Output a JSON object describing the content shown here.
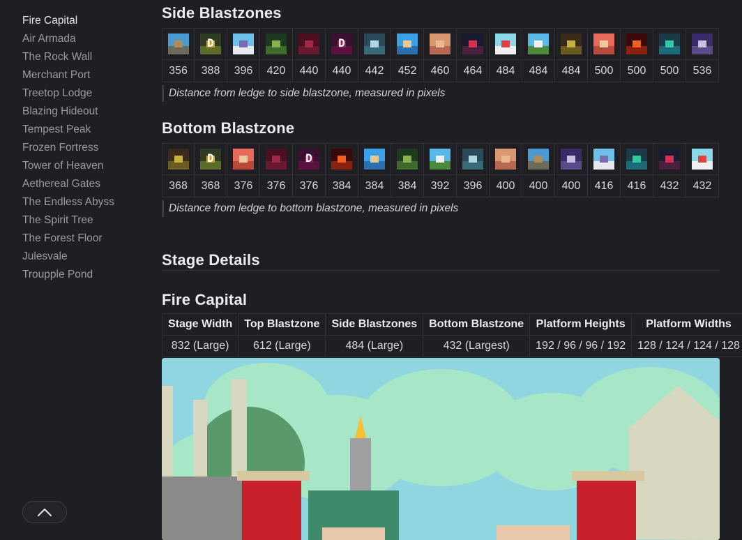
{
  "sidebar": {
    "items": [
      {
        "label": "Fire Capital",
        "active": true
      },
      {
        "label": "Air Armada"
      },
      {
        "label": "The Rock Wall"
      },
      {
        "label": "Merchant Port"
      },
      {
        "label": "Treetop Lodge"
      },
      {
        "label": "Blazing Hideout"
      },
      {
        "label": "Tempest Peak"
      },
      {
        "label": "Frozen Fortress"
      },
      {
        "label": "Tower of Heaven"
      },
      {
        "label": "Aethereal Gates"
      },
      {
        "label": "The Endless Abyss"
      },
      {
        "label": "The Spirit Tree"
      },
      {
        "label": "The Forest Floor"
      },
      {
        "label": "Julesvale"
      },
      {
        "label": "Troupple Pond"
      }
    ],
    "scroll_top_icon": "chevron-up-icon"
  },
  "side": {
    "heading": "Side Blastzones",
    "caption": "Distance from ledge to side blastzone, measured in pixels",
    "entries": [
      {
        "value": "356",
        "sky": "#4a9bd1",
        "ground": "#6b6b5a",
        "block": "#b08a5a",
        "glyph": ""
      },
      {
        "value": "388",
        "sky": "#2f3a22",
        "ground": "#5a6b2a",
        "block": "#c8a030",
        "glyph": "D"
      },
      {
        "value": "396",
        "sky": "#6fc0e8",
        "ground": "#e8e8f0",
        "block": "#7a6ab0",
        "glyph": ""
      },
      {
        "value": "420",
        "sky": "#1e3a1e",
        "ground": "#3e6b2a",
        "block": "#8ab050",
        "glyph": ""
      },
      {
        "value": "440",
        "sky": "#4a1020",
        "ground": "#6a1830",
        "block": "#a02848",
        "glyph": ""
      },
      {
        "value": "440",
        "sky": "#3a1030",
        "ground": "#5a1040",
        "block": "#8a2050",
        "glyph": "D"
      },
      {
        "value": "442",
        "sky": "#2a4a5a",
        "ground": "#3a6a7a",
        "block": "#b0d8e0",
        "glyph": ""
      },
      {
        "value": "452",
        "sky": "#3aa0e8",
        "ground": "#2a70b0",
        "block": "#e8c890",
        "glyph": ""
      },
      {
        "value": "460",
        "sky": "#d89870",
        "ground": "#b86850",
        "block": "#e8b890",
        "glyph": ""
      },
      {
        "value": "464",
        "sky": "#1a1a30",
        "ground": "#4a2040",
        "block": "#d83050",
        "glyph": ""
      },
      {
        "value": "484",
        "sky": "#8ad8e8",
        "ground": "#f0f0f0",
        "block": "#e04040",
        "glyph": ""
      },
      {
        "value": "484",
        "sky": "#5ab8e8",
        "ground": "#4a8a3a",
        "block": "#f0f0f0",
        "glyph": ""
      },
      {
        "value": "484",
        "sky": "#3a2a1a",
        "ground": "#6a5a20",
        "block": "#c8b040",
        "glyph": ""
      },
      {
        "value": "500",
        "sky": "#e86a5a",
        "ground": "#b84a3a",
        "block": "#f0c8a0",
        "glyph": ""
      },
      {
        "value": "500",
        "sky": "#3a0a0a",
        "ground": "#8a2010",
        "block": "#f06020",
        "glyph": ""
      },
      {
        "value": "500",
        "sky": "#1a3a4a",
        "ground": "#1a6a7a",
        "block": "#30c8a0",
        "glyph": ""
      },
      {
        "value": "536",
        "sky": "#3a2a6a",
        "ground": "#5a4a8a",
        "block": "#c8c0e0",
        "glyph": ""
      }
    ]
  },
  "bottom": {
    "heading": "Bottom Blastzone",
    "caption": "Distance from ledge to bottom blastzone, measured in pixels",
    "entries": [
      {
        "value": "368",
        "sky": "#3a2a1a",
        "ground": "#6a5a20",
        "block": "#c8b040",
        "glyph": ""
      },
      {
        "value": "368",
        "sky": "#2f3a22",
        "ground": "#5a6b2a",
        "block": "#c8a030",
        "glyph": "D"
      },
      {
        "value": "376",
        "sky": "#e86a5a",
        "ground": "#b84a3a",
        "block": "#f0c8a0",
        "glyph": ""
      },
      {
        "value": "376",
        "sky": "#4a1020",
        "ground": "#6a1830",
        "block": "#a02848",
        "glyph": ""
      },
      {
        "value": "376",
        "sky": "#3a1030",
        "ground": "#5a1040",
        "block": "#8a2050",
        "glyph": "D"
      },
      {
        "value": "384",
        "sky": "#3a0a0a",
        "ground": "#8a2010",
        "block": "#f06020",
        "glyph": ""
      },
      {
        "value": "384",
        "sky": "#3aa0e8",
        "ground": "#2a70b0",
        "block": "#e8c890",
        "glyph": ""
      },
      {
        "value": "384",
        "sky": "#1e3a1e",
        "ground": "#3e6b2a",
        "block": "#8ab050",
        "glyph": ""
      },
      {
        "value": "392",
        "sky": "#5ab8e8",
        "ground": "#4a8a3a",
        "block": "#f0f0f0",
        "glyph": ""
      },
      {
        "value": "396",
        "sky": "#2a4a5a",
        "ground": "#3a6a7a",
        "block": "#b0d8e0",
        "glyph": ""
      },
      {
        "value": "400",
        "sky": "#d89870",
        "ground": "#b86850",
        "block": "#e8b890",
        "glyph": ""
      },
      {
        "value": "400",
        "sky": "#4a9bd1",
        "ground": "#6b6b5a",
        "block": "#b08a5a",
        "glyph": ""
      },
      {
        "value": "400",
        "sky": "#3a2a6a",
        "ground": "#5a4a8a",
        "block": "#c8c0e0",
        "glyph": ""
      },
      {
        "value": "416",
        "sky": "#6fc0e8",
        "ground": "#e8e8f0",
        "block": "#7a6ab0",
        "glyph": ""
      },
      {
        "value": "416",
        "sky": "#1a3a4a",
        "ground": "#1a6a7a",
        "block": "#30c8a0",
        "glyph": ""
      },
      {
        "value": "432",
        "sky": "#1a1a30",
        "ground": "#4a2040",
        "block": "#d83050",
        "glyph": ""
      },
      {
        "value": "432",
        "sky": "#8ad8e8",
        "ground": "#f0f0f0",
        "block": "#e04040",
        "glyph": ""
      }
    ]
  },
  "details": {
    "heading": "Stage Details",
    "stage_name": "Fire Capital",
    "columns": [
      "Stage Width",
      "Top Blastzone",
      "Side Blastzones",
      "Bottom Blastzone",
      "Platform Heights",
      "Platform Widths"
    ],
    "values": [
      "832 (Large)",
      "612 (Large)",
      "484 (Large)",
      "432 (Largest)",
      "192 / 96 / 96 / 192",
      "128 / 124 / 124 / 128"
    ]
  },
  "stage_image": {
    "sky_color": "#8fd6e0",
    "cloud_color": "#a8e6c8",
    "stone_color": "#d8d8c0",
    "banner_color": "#c8202a",
    "flame_color": "#f8c030"
  }
}
